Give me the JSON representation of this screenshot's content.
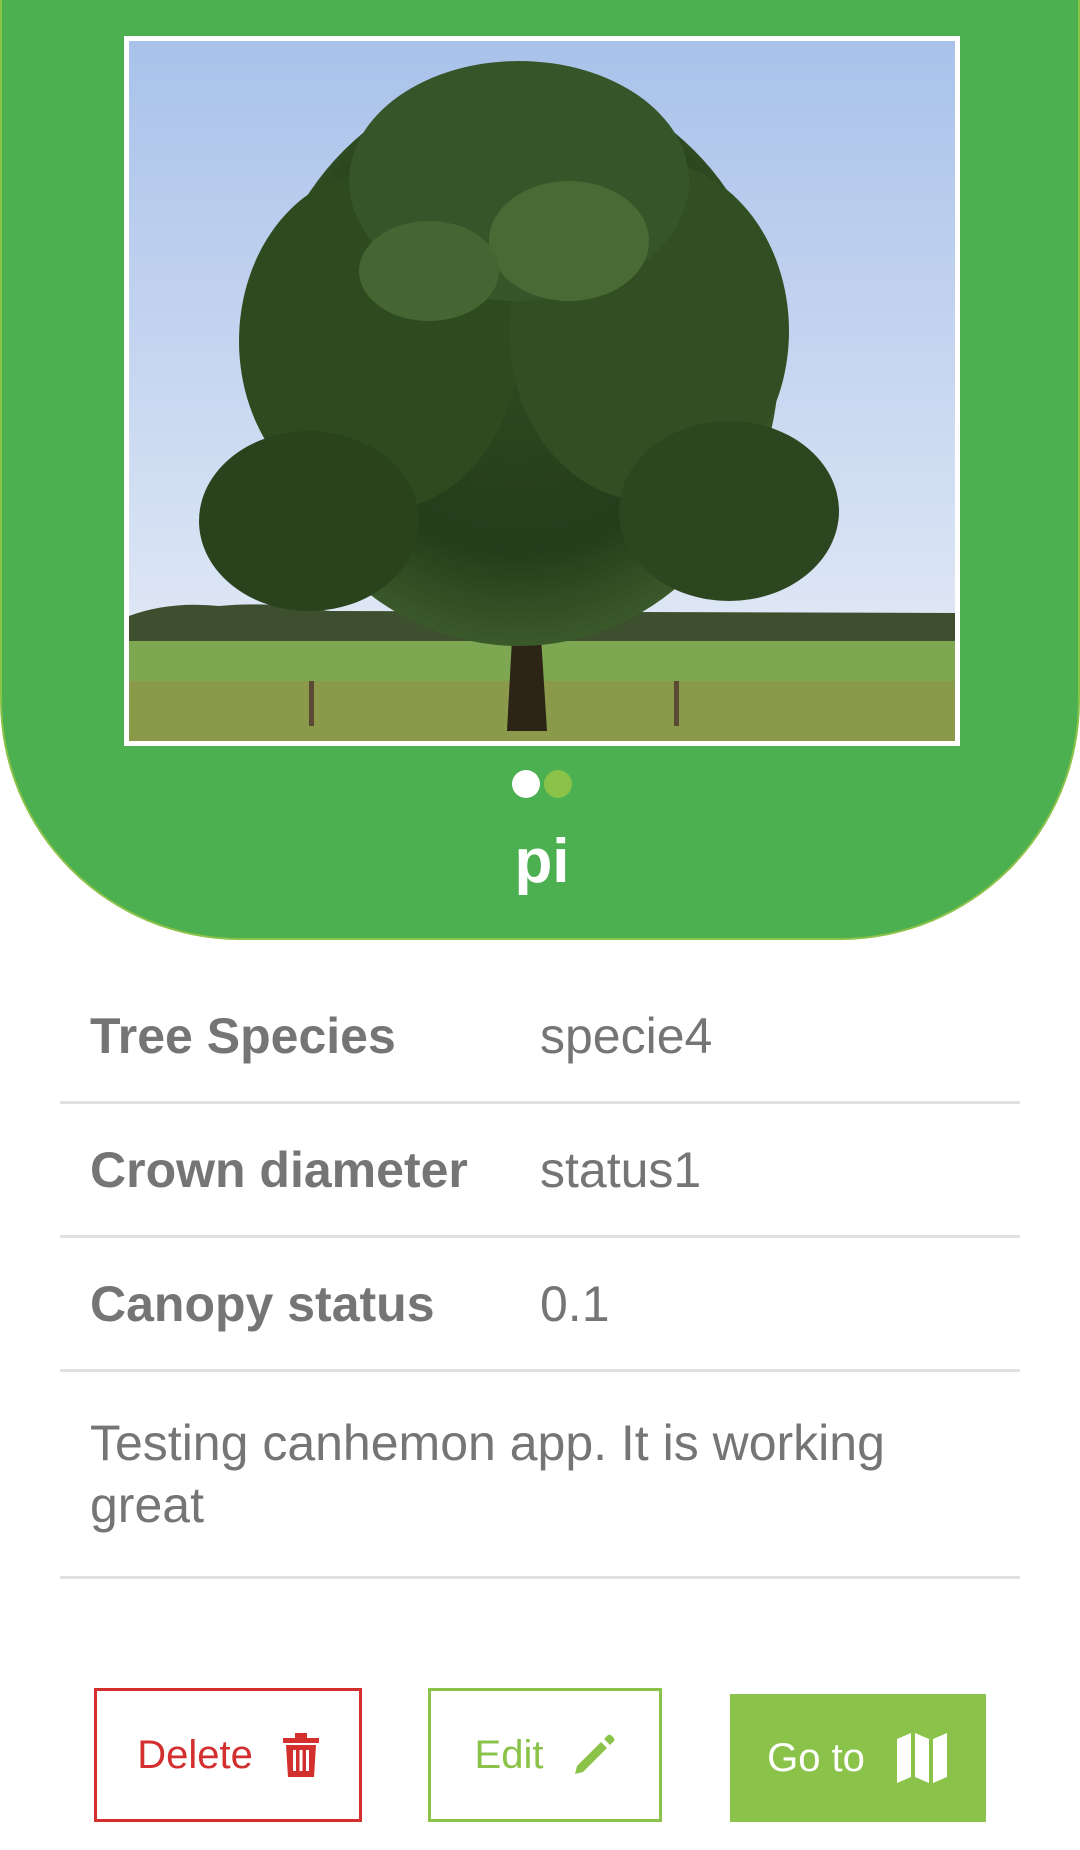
{
  "tree": {
    "name": "pi",
    "photo_count": 2,
    "active_photo_index": 0
  },
  "details": [
    {
      "label": "Tree Species",
      "value": "specie4"
    },
    {
      "label": "Crown diameter",
      "value": "status1"
    },
    {
      "label": "Canopy status",
      "value": "0.1"
    }
  ],
  "notes": "Testing canhemon app. It is working great",
  "actions": {
    "delete_label": "Delete",
    "edit_label": "Edit",
    "goto_label": "Go to"
  },
  "icons": {
    "delete": "trash-icon",
    "edit": "pencil-icon",
    "goto": "map-icon"
  },
  "colors": {
    "header_green": "#4caf50",
    "accent_green": "#8bc34a",
    "danger_red": "#d32f2f",
    "text_gray": "#757575"
  }
}
